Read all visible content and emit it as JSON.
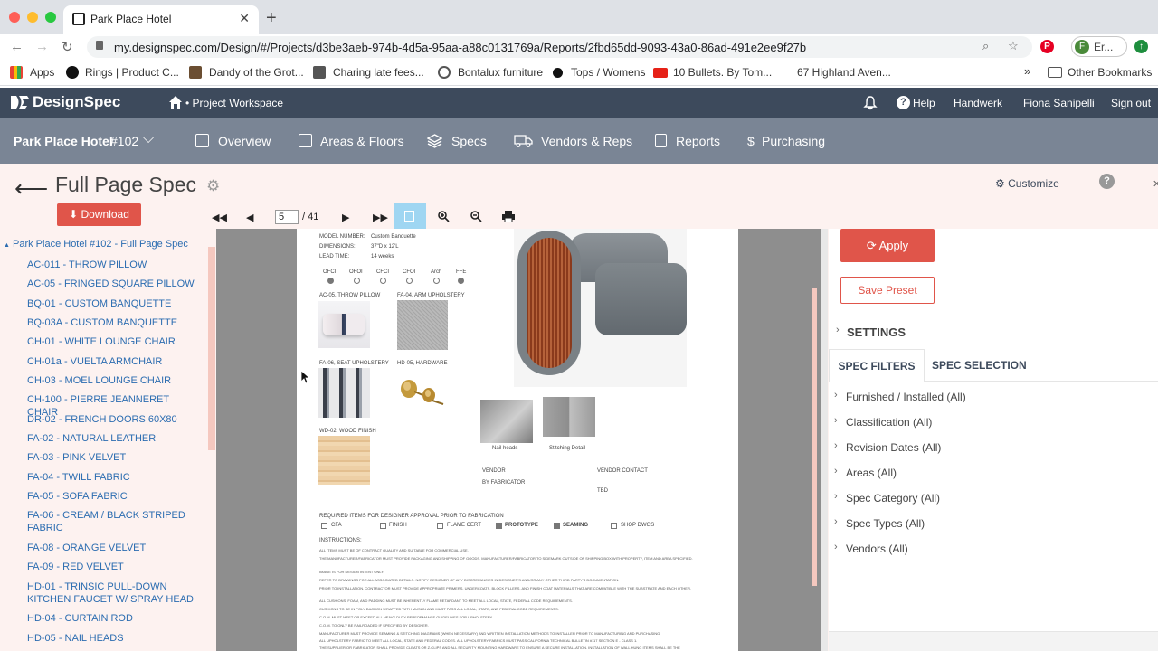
{
  "browser": {
    "tab_title": "Park Place Hotel",
    "url": "my.designspec.com/Design/#/Projects/d3be3aeb-974b-4d5a-95aa-a88c0131769a/Reports/2fbd65dd-9093-43a0-86ad-491e2ee9f27b",
    "profile_label": "Er...",
    "profile_initial": "F",
    "bookmarks": [
      {
        "label": "Apps"
      },
      {
        "label": "Rings | Product C..."
      },
      {
        "label": "Dandy of the Grot..."
      },
      {
        "label": "Charing late fees..."
      },
      {
        "label": "Bontalux furniture"
      },
      {
        "label": "Tops / Womens"
      },
      {
        "label": "10 Bullets. By Tom..."
      },
      {
        "label": "67 Highland Aven..."
      }
    ],
    "bookmarks_more": "»",
    "other_bookmarks": "Other Bookmarks"
  },
  "app": {
    "logo": "DesignSpec",
    "workspace": "• Project Workspace",
    "help": "Help",
    "company": "Handwerk",
    "user": "Fiona Sanipelli",
    "sign_out": "Sign out"
  },
  "project": {
    "name": "Park Place Hotel",
    "number": "#102",
    "nav": [
      {
        "label": "Overview"
      },
      {
        "label": "Areas & Floors"
      },
      {
        "label": "Specs"
      },
      {
        "label": "Vendors & Reps"
      },
      {
        "label": "Reports"
      },
      {
        "label": "Purchasing"
      }
    ]
  },
  "page": {
    "title": "Full Page Spec",
    "download": "Download",
    "customize": "Customize"
  },
  "viewer": {
    "current_page": "5",
    "total_pages": "/ 41"
  },
  "spec_list": {
    "root": "Park Place Hotel #102 - Full Page Spec",
    "items": [
      "AC-011 - THROW PILLOW",
      "AC-05 - FRINGED SQUARE PILLOW",
      "BQ-01 - CUSTOM BANQUETTE",
      "BQ-03A - CUSTOM BANQUETTE",
      "CH-01 - WHITE LOUNGE CHAIR",
      "CH-01a - VUELTA ARMCHAIR",
      "CH-03 - MOEL LOUNGE CHAIR",
      "CH-100 - PIERRE JEANNERET CHAIR",
      "DR-02 - FRENCH DOORS 60X80",
      "FA-02 - NATURAL LEATHER",
      "FA-03 - PINK VELVET",
      "FA-04 - TWILL FABRIC",
      "FA-05 - SOFA FABRIC",
      "FA-06 - CREAM / BLACK STRIPED FABRIC",
      "FA-08 - ORANGE VELVET",
      "FA-09 - RED VELVET",
      "HD-01 - TRINSIC PULL-DOWN KITCHEN FAUCET W/ SPRAY HEAD",
      "HD-04 - CURTAIN ROD",
      "HD-05 - NAIL HEADS"
    ]
  },
  "document": {
    "model_number_label": "MODEL NUMBER:",
    "model_number": "Custom Banquette",
    "dimensions_label": "DIMENSIONS:",
    "dimensions": "37\"D x 12'L",
    "lead_time_label": "LEAD TIME:",
    "lead_time": "14 weeks",
    "options": [
      "OFCI",
      "OFOI",
      "CFCI",
      "CFOI",
      "Arch",
      "FFE"
    ],
    "swatches": [
      "AC-05, THROW PILLOW",
      "FA-04, ARM UPHOLSTERY",
      "FA-06, SEAT UPHOLSTERY",
      "HD-05, HARDWARE",
      "WD-02, WOOD FINISH"
    ],
    "detail_images": [
      "Nail heads",
      "Stitching Detail"
    ],
    "vendor_label": "VENDOR",
    "vendor": "BY FABRICATOR",
    "vendor_contact_label": "VENDOR CONTACT",
    "vendor_contact": "TBD",
    "required_heading": "REQUIRED ITEMS FOR DESIGNER APPROVAL PRIOR TO FABRICATION",
    "required_items": [
      "CFA",
      "FINISH",
      "FLAME CERT",
      "PROTOTYPE",
      "SEAMING",
      "SHOP DWGS"
    ],
    "instructions_label": "INSTRUCTIONS:",
    "instructions": [
      "ALL ITEMS MUST BE OF CONTRACT QUALITY AND SUITABLE FOR COMMERCIAL USE.",
      "THE MANUFACTURER/FABRICATOR MUST PROVIDE PACKAGING AND SHIPPING OF GOODS. MANUFACTURER/FABRICATOR TO SIDEMARK OUTSIDE OF SHIPPING BOX WITH PROPERTY, ITEM AND AREA SPECIFIED.",
      "IMAGE IS FOR DESIGN INTENT ONLY.",
      "REFER TO DRAWINGS FOR ALL ASSOCIATED DETAILS. NOTIFY DESIGNER OF ANY DISCREPANCIES IN DESIGNER'S AND/OR ANY OTHER THIRD PARTY'S DOCUMENTATION.",
      "PRIOR TO INSTALLATION, CONTRACTOR MUST PROVIDE APPROPRIATE PRIMERS, UNDERCOATS, BLOCK FILLERS, AND FINISH COAT MATERIALS THAT ARE COMPATIBLE WITH THE SUBSTRATE AND EACH OTHER.",
      "ALL CUSHIONS, FOAM, AND PADDING MUST BE INHERENTLY FLAME RETARDANT TO MEET ALL LOCAL, STATE, FEDERAL CODE REQUIREMENTS.",
      "CUSHIONS TO BE IN POLY DACRON WRAPPED WITH MUSLIN AND MUST PASS ALL LOCAL, STATE, AND FEDERAL CODE REQUIREMENTS.",
      "C.O.M. MUST MEET OR EXCEED ALL HEAVY DUTY PERFORMANCE GUIDELINES FOR UPHOLSTERY.",
      "C.O.M. TO ONLY BE RAILROADED IF SPECIFIED BY DESIGNER.",
      "MANUFACTURER MUST PROVIDE SEAMING & STITCHING DIAGRAMS (WHEN NECESSARY) AND WRITTEN INSTALLATION METHODS TO INSTALLER PRIOR TO MANUFACTURING AND PURCHASING.",
      "ALL UPHOLSTERY FABRIC TO MEET ALL LOCAL, STATE AND FEDERAL CODES. ALL UPHOLSTERY FABRICS MUST PASS CALIFORNIA TECHNICAL BULLETIN #117 SECTION E - CLASS 1.",
      "THE SUPPLIER OR FABRICATOR SHALL PROVIDE CLEATS OR Z-CLIPS AND ALL SECURITY MOUNTING HARDWARE TO ENSURE A SECURE INSTALLATION. INSTALLATION OF WALL HUNG ITEMS SHALL BE THE"
    ]
  },
  "right_panel": {
    "apply": "Apply",
    "save_preset": "Save Preset",
    "settings": "SETTINGS",
    "tab_filters": "SPEC FILTERS",
    "tab_selection": "SPEC SELECTION",
    "filters": [
      "Furnished / Installed (All)",
      "Classification (All)",
      "Revision Dates (All)",
      "Areas (All)",
      "Spec Category (All)",
      "Spec Types (All)",
      "Vendors (All)"
    ]
  },
  "colors": {
    "app_header": "#3d4a5c",
    "project_bar": "#7a8595",
    "accent": "#e0554a",
    "link": "#2b6cb0",
    "page_bg": "#fdf2f0"
  }
}
